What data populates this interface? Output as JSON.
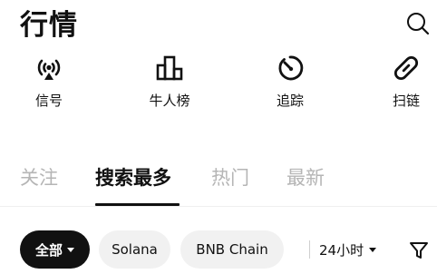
{
  "header": {
    "title": "行情",
    "search_icon": "search-icon"
  },
  "shortcuts": [
    {
      "label": "信号",
      "icon": "signal-broadcast-icon"
    },
    {
      "label": "牛人榜",
      "icon": "leaderboard-icon"
    },
    {
      "label": "追踪",
      "icon": "tracking-icon"
    },
    {
      "label": "扫链",
      "icon": "chain-link-icon"
    }
  ],
  "tabs": [
    {
      "label": "关注",
      "active": false
    },
    {
      "label": "搜索最多",
      "active": true
    },
    {
      "label": "热门",
      "active": false
    },
    {
      "label": "最新",
      "active": false
    }
  ],
  "filters": {
    "chips": [
      {
        "label": "全部",
        "active": true,
        "has_dropdown": true
      },
      {
        "label": "Solana",
        "active": false
      },
      {
        "label": "BNB Chain",
        "active": false
      }
    ],
    "time_range": "24小时",
    "filter_icon": "filter-icon"
  },
  "colors": {
    "text_primary": "#111111",
    "text_inactive": "#b5b5b5",
    "chip_bg": "#f1f1f1",
    "chip_active_bg": "#111111"
  }
}
